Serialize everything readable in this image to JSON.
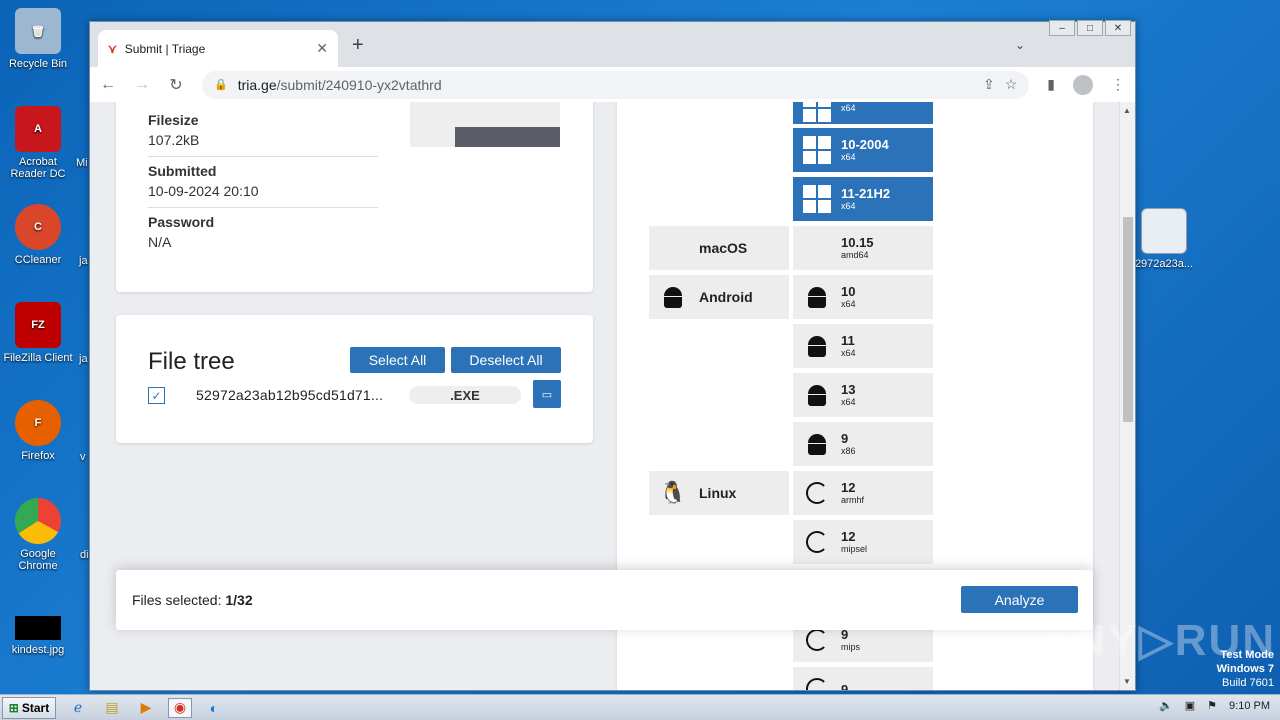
{
  "desktop": {
    "icons": [
      {
        "label": "Recycle Bin"
      },
      {
        "label": "Acrobat Reader DC"
      },
      {
        "label": "CCleaner"
      },
      {
        "label": "FileZilla Client"
      },
      {
        "label": "Firefox"
      },
      {
        "label": "Google Chrome"
      },
      {
        "label": "kindest.jpg"
      }
    ],
    "cut_labels": [
      "Mi",
      "ja",
      "ja",
      "v",
      "di"
    ],
    "right_icon_label": "2972a23a...",
    "watermark": "ANY▷RUN",
    "testmode": {
      "line1": "Test Mode",
      "line2": "Windows 7",
      "line3": "Build 7601"
    }
  },
  "browser": {
    "tab_title": "Submit | Triage",
    "url_host": "tria.ge",
    "url_path": "/submit/240910-yx2vtathrd"
  },
  "info": {
    "filesize_label": "Filesize",
    "filesize_value": "107.2kB",
    "submitted_label": "Submitted",
    "submitted_value": "10-09-2024 20:10",
    "password_label": "Password",
    "password_value": "N/A"
  },
  "file_tree": {
    "title": "File tree",
    "select_all": "Select All",
    "deselect_all": "Deselect All",
    "file_name": "52972a23ab12b95cd51d71...",
    "file_ext": ".EXE"
  },
  "os": {
    "labels": {
      "macos": "macOS",
      "android": "Android",
      "linux": "Linux"
    },
    "items": [
      {
        "ver": "",
        "arch": "x64"
      },
      {
        "ver": "10-2004",
        "arch": "x64"
      },
      {
        "ver": "11-21H2",
        "arch": "x64"
      },
      {
        "ver": "10.15",
        "arch": "amd64"
      },
      {
        "ver": "10",
        "arch": "x64"
      },
      {
        "ver": "11",
        "arch": "x64"
      },
      {
        "ver": "13",
        "arch": "x64"
      },
      {
        "ver": "9",
        "arch": "x86"
      },
      {
        "ver": "12",
        "arch": "armhf"
      },
      {
        "ver": "12",
        "arch": "mipsel"
      },
      {
        "ver": "9",
        "arch": "mips"
      },
      {
        "ver": "9",
        "arch": ""
      }
    ]
  },
  "bottom": {
    "files_selected_label": "Files selected: ",
    "files_selected_value": "1/32",
    "analyze": "Analyze"
  },
  "taskbar": {
    "start": "Start",
    "time": "9:10 PM"
  }
}
